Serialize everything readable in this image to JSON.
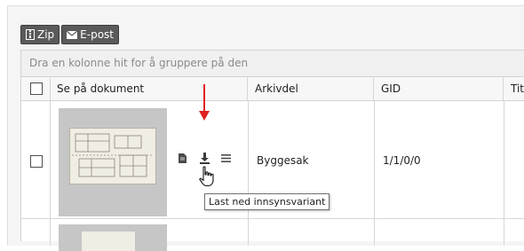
{
  "toolbar": {
    "zip_label": "Zip",
    "email_label": "E-post"
  },
  "grid": {
    "group_hint": "Dra en kolonne hit for å gruppere på den",
    "columns": [
      "Se på dokument",
      "Arkivdel",
      "GID",
      "Titt"
    ],
    "rows": [
      {
        "arkivdel": "Byggesak",
        "gid": "1/1/0/0"
      }
    ]
  },
  "tooltip": "Last ned innsynsvariant",
  "colors": {
    "toolbar_button": "#5a5a5a",
    "arrow": "#e02020"
  },
  "icons": [
    "zip-file-icon",
    "envelope-icon",
    "document-icon",
    "download-icon",
    "menu-icon",
    "hand-cursor-icon",
    "arrow-down-icon"
  ]
}
